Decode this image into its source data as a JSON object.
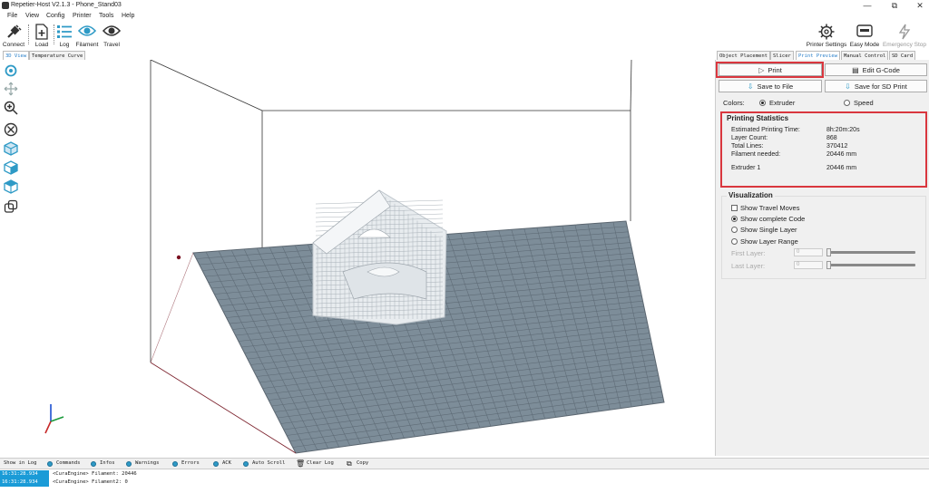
{
  "window": {
    "title": "Repetier-Host V2.1.3 - Phone_Stand03",
    "controls": [
      "—",
      "⧉",
      "✕"
    ]
  },
  "menu": [
    "File",
    "View",
    "Config",
    "Printer",
    "Tools",
    "Help"
  ],
  "toolbar": {
    "left": [
      "Connect",
      "Load",
      "Log",
      "Filament",
      "Travel"
    ],
    "right": [
      "Printer Settings",
      "Easy Mode",
      "Emergency Stop"
    ]
  },
  "view_tabs": [
    "3D View",
    "Temperature Curve"
  ],
  "right_tabs": [
    "Object Placement",
    "Slicer",
    "Print Preview",
    "Manual Control",
    "SD Card"
  ],
  "preview": {
    "print_label": "Print",
    "edit_gcode_label": "Edit G-Code",
    "save_file_label": "Save to File",
    "save_sd_label": "Save for SD Print",
    "colors_label": "Colors:",
    "color_options": [
      "Extruder",
      "Speed"
    ],
    "selected_color": "Extruder"
  },
  "statistics": {
    "title": "Printing Statistics",
    "rows": [
      {
        "label": "Estimated Printing Time:",
        "value": "8h:20m:20s"
      },
      {
        "label": "Layer Count:",
        "value": "868"
      },
      {
        "label": "Total Lines:",
        "value": "370412"
      },
      {
        "label": "Filament needed:",
        "value": "20446 mm"
      },
      {
        "label": "Extruder 1",
        "value": "20446 mm"
      }
    ]
  },
  "visualization": {
    "title": "Visualization",
    "show_travel_moves": "Show Travel Moves",
    "options": [
      "Show complete Code",
      "Show Single Layer",
      "Show Layer Range"
    ],
    "selected": "Show complete Code",
    "first_layer_label": "First Layer:",
    "last_layer_label": "Last Layer:",
    "first_layer_value": "0",
    "last_layer_value": "0"
  },
  "logbar": {
    "show_in_log": "Show in Log",
    "filters": [
      "Commands",
      "Infos",
      "Warnings",
      "Errors",
      "ACK",
      "Auto Scroll"
    ],
    "clear_log": "Clear Log",
    "copy": "Copy"
  },
  "log": [
    {
      "time": "16:31:28.934",
      "message": "<CuraEngine> Filament: 20446"
    },
    {
      "time": "16:31:28.934",
      "message": "<CuraEngine> Filament2: 0"
    }
  ],
  "colors": {
    "accent": "#2a7fc9",
    "highlight_box": "#d9363e",
    "bed": "#7d8d99",
    "log_timestamp": "#1a9bd7"
  }
}
